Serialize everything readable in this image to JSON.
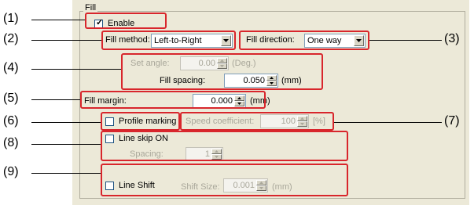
{
  "group_title": "Fill",
  "callouts": [
    "(1)",
    "(2)",
    "(3)",
    "(4)",
    "(5)",
    "(6)",
    "(7)",
    "(8)",
    "(9)"
  ],
  "enable": {
    "label": "Enable",
    "checked": true
  },
  "fill_method": {
    "label": "Fill method:",
    "value": "Left-to-Right"
  },
  "fill_direction": {
    "label": "Fill direction:",
    "value": "One way"
  },
  "set_angle": {
    "label": "Set angle:",
    "value": "0.00",
    "unit": "(Deg.)"
  },
  "fill_spacing": {
    "label": "Fill spacing:",
    "value": "0.050",
    "unit": "(mm)"
  },
  "fill_margin": {
    "label": "Fill margin:",
    "value": "0.000",
    "unit": "(mm)"
  },
  "profile_marking": {
    "label": "Profile marking",
    "checked": false
  },
  "speed_coefficient": {
    "label": "Speed coefficient:",
    "value": "100",
    "unit": "[%]"
  },
  "line_skip": {
    "label": "Line skip ON",
    "checked": false,
    "spacing_label": "Spacing:",
    "spacing_value": "1"
  },
  "line_shift": {
    "label": "Line Shift",
    "checked": false,
    "size_label": "Shift Size:",
    "size_value": "0.001",
    "unit": "(mm)"
  },
  "colors": {
    "highlight": "#d8262c",
    "panel": "#ece9d8",
    "disabled_text": "#a9a79a"
  }
}
